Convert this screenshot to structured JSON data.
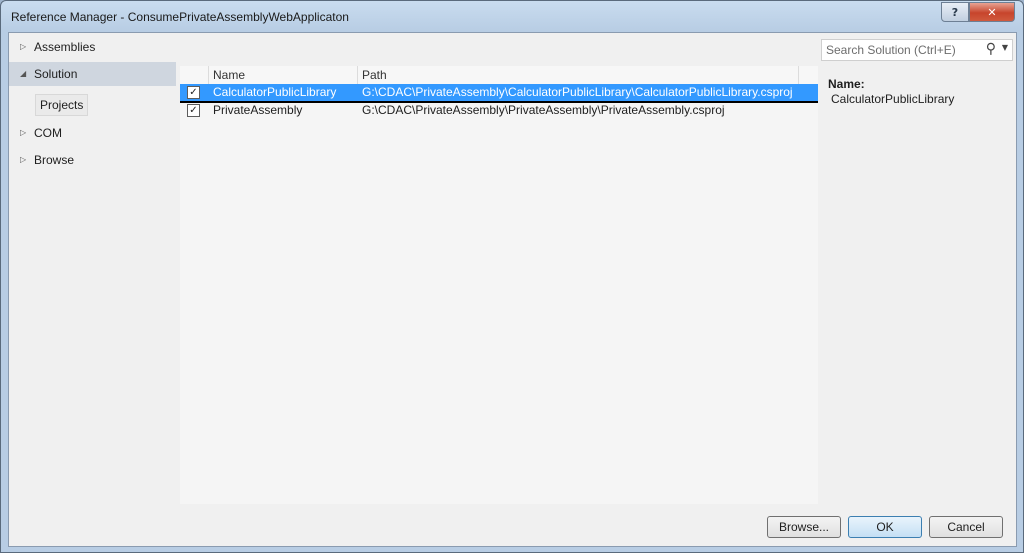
{
  "window": {
    "title": "Reference Manager - ConsumePrivateAssemblyWebApplicaton",
    "help_glyph": "?",
    "close_glyph": "✕"
  },
  "nav": {
    "items": [
      {
        "label": "Assemblies",
        "arrow": "▷"
      },
      {
        "label": "Solution",
        "arrow": "◢"
      },
      {
        "label": "COM",
        "arrow": "▷"
      },
      {
        "label": "Browse",
        "arrow": "▷"
      }
    ],
    "sub_item": "Projects"
  },
  "list": {
    "columns": [
      "Name",
      "Path"
    ],
    "rows": [
      {
        "checked": true,
        "name": "CalculatorPublicLibrary",
        "path": "G:\\CDAC\\PrivateAssembly\\CalculatorPublicLibrary\\CalculatorPublicLibrary.csproj",
        "selected": true
      },
      {
        "checked": true,
        "name": "PrivateAssembly",
        "path": "G:\\CDAC\\PrivateAssembly\\PrivateAssembly\\PrivateAssembly.csproj",
        "selected": false
      }
    ]
  },
  "details": {
    "search_placeholder": "Search Solution (Ctrl+E)",
    "name_label": "Name:",
    "name_value": "CalculatorPublicLibrary"
  },
  "buttons": {
    "browse": "Browse...",
    "ok": "OK",
    "cancel": "Cancel"
  },
  "colors": {
    "selection": "#3399ff",
    "nav_selected": "#cfd6df"
  }
}
